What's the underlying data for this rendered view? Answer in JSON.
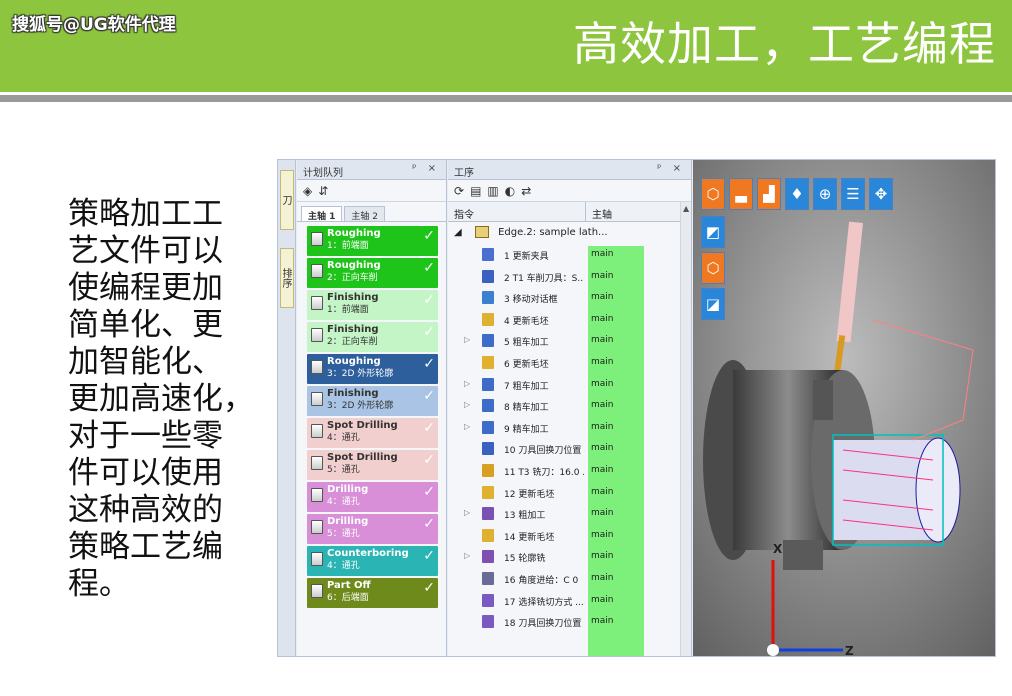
{
  "header": {
    "watermark": "搜狐号@UG软件代理",
    "title": "高效加工，工艺编程"
  },
  "body_lines": [
    "策略加工工",
    "艺文件可以",
    "使编程更加",
    "简单化、更",
    "加智能化、",
    "更加高速化，",
    "对于一些零",
    "件可以使用",
    "这种高效的",
    "策略工艺编",
    "程。"
  ],
  "app": {
    "side_tabs": [
      "刀",
      "排序"
    ],
    "queue": {
      "title": "计划队列",
      "controls": "ᵖ ×",
      "toolbar": [
        "◈",
        "⇵"
      ],
      "tabs": [
        "主轴 1",
        "主轴 2"
      ],
      "items": [
        {
          "name": "Roughing",
          "sub": "1：前端面",
          "bg": "#1fc41b",
          "fg": "#ffffff"
        },
        {
          "name": "Roughing",
          "sub": "2：正向车削",
          "bg": "#1fc41b",
          "fg": "#ffffff"
        },
        {
          "name": "Finishing",
          "sub": "1：前端面",
          "bg": "#c4f5c6",
          "fg": "#333333"
        },
        {
          "name": "Finishing",
          "sub": "2：正向车削",
          "bg": "#c4f5c6",
          "fg": "#333333"
        },
        {
          "name": "Roughing",
          "sub": "3：2D 外形轮廓",
          "bg": "#2c5f9c",
          "fg": "#ffffff"
        },
        {
          "name": "Finishing",
          "sub": "3：2D 外形轮廓",
          "bg": "#a9c4e4",
          "fg": "#333333"
        },
        {
          "name": "Spot Drilling",
          "sub": "4：通孔",
          "bg": "#f2cfcf",
          "fg": "#333333"
        },
        {
          "name": "Spot Drilling",
          "sub": "5：通孔",
          "bg": "#f2cfcf",
          "fg": "#333333"
        },
        {
          "name": "Drilling",
          "sub": "4：通孔",
          "bg": "#d88fd8",
          "fg": "#ffffff"
        },
        {
          "name": "Drilling",
          "sub": "5：通孔",
          "bg": "#d88fd8",
          "fg": "#ffffff"
        },
        {
          "name": "Counterboring",
          "sub": "4：通孔",
          "bg": "#2ab4b4",
          "fg": "#ffffff"
        },
        {
          "name": "Part Off",
          "sub": "6：后端面",
          "bg": "#6e8a1a",
          "fg": "#ffffff"
        }
      ]
    },
    "operations": {
      "title": "工序",
      "controls": "ᵖ ×",
      "toolbar": [
        "⟳",
        "▤",
        "▥",
        "◐",
        "⇄"
      ],
      "columns": [
        "指令",
        "主轴"
      ],
      "root": "Edge.2: sample lath...",
      "rows": [
        {
          "label": "1 更新夹具",
          "spindle": "main",
          "color": "#4a6ed0",
          "expand": ""
        },
        {
          "label": "2 T1 车削刀具：S...",
          "spindle": "main",
          "color": "#3a60c0",
          "expand": ""
        },
        {
          "label": "3 移动对话框",
          "spindle": "main",
          "color": "#3b7fd0",
          "expand": ""
        },
        {
          "label": "4 更新毛坯",
          "spindle": "main",
          "color": "#e0b030",
          "expand": ""
        },
        {
          "label": "5 粗车加工",
          "spindle": "main",
          "color": "#3c6bc8",
          "expand": "▷"
        },
        {
          "label": "6 更新毛坯",
          "spindle": "main",
          "color": "#e0b030",
          "expand": ""
        },
        {
          "label": "7 粗车加工",
          "spindle": "main",
          "color": "#3c6bc8",
          "expand": "▷"
        },
        {
          "label": "8 精车加工",
          "spindle": "main",
          "color": "#3c6bc8",
          "expand": "▷"
        },
        {
          "label": "9 精车加工",
          "spindle": "main",
          "color": "#3c6bc8",
          "expand": "▷"
        },
        {
          "label": "10 刀具回换刀位置",
          "spindle": "main",
          "color": "#3a60c0",
          "expand": ""
        },
        {
          "label": "11 T3 铣刀：16.0 ...",
          "spindle": "main",
          "color": "#d8a020",
          "expand": ""
        },
        {
          "label": "12 更新毛坯",
          "spindle": "main",
          "color": "#e0b030",
          "expand": ""
        },
        {
          "label": "13 粗加工",
          "spindle": "main",
          "color": "#7a50b0",
          "expand": "▷"
        },
        {
          "label": "14 更新毛坯",
          "spindle": "main",
          "color": "#e0b030",
          "expand": ""
        },
        {
          "label": "15 轮廓铣",
          "spindle": "main",
          "color": "#8050b0",
          "expand": "▷"
        },
        {
          "label": "16 角度进给：C 0",
          "spindle": "main",
          "color": "#6a6a9a",
          "expand": ""
        },
        {
          "label": "17 选择铣切方式 ...",
          "spindle": "main",
          "color": "#7a5ac0",
          "expand": ""
        },
        {
          "label": "18 刀具回换刀位置",
          "spindle": "main",
          "color": "#7a5ac0",
          "expand": ""
        }
      ]
    },
    "viewport": {
      "tools": [
        {
          "icon": "cube-icon",
          "glyph": "⬡",
          "style": "orange"
        },
        {
          "icon": "lathe-icon",
          "glyph": "▃",
          "style": "orange"
        },
        {
          "icon": "tool-holder-icon",
          "glyph": "▟",
          "style": "orange"
        },
        {
          "icon": "drill-icon",
          "glyph": "♦",
          "style": "blue"
        },
        {
          "icon": "zoom-icon",
          "glyph": "⊕",
          "style": "blue"
        },
        {
          "icon": "list-icon",
          "glyph": "☰",
          "style": "blue"
        },
        {
          "icon": "axes-icon",
          "glyph": "✥",
          "style": "blue"
        }
      ],
      "tools2": [
        {
          "icon": "view-iso-icon",
          "glyph": "◩",
          "style": "blue"
        },
        {
          "icon": "view-box-icon",
          "glyph": "⬡",
          "style": "orange"
        },
        {
          "icon": "view-shade-icon",
          "glyph": "◪",
          "style": "blue"
        }
      ],
      "axis_x": "X",
      "axis_z": "Z"
    }
  }
}
